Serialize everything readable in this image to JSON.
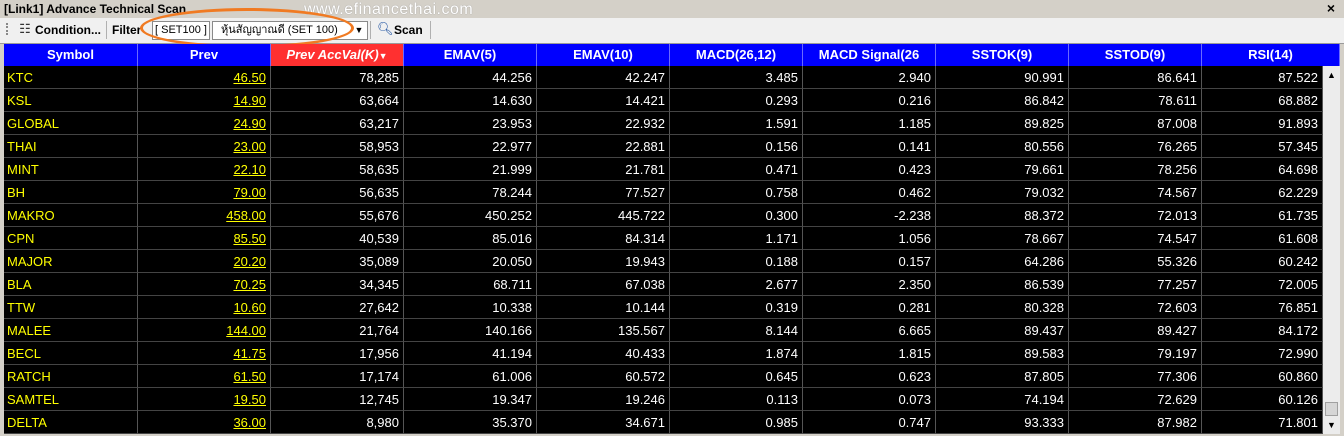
{
  "window": {
    "title": "[Link1] Advance Technical Scan",
    "watermark": "www.efinancethai.com",
    "close_glyph": "×"
  },
  "toolbar": {
    "condition_label": "Condition...",
    "filter_label": "Filter",
    "filter_value": "[ SET100 ]",
    "combo_value": "หุ้นสัญญาณดี (SET 100)",
    "scan_label": "Scan"
  },
  "icons": {
    "condition": "grid-settings-icon",
    "scan": "magnifier-icon",
    "combo_arrow": "dropdown-arrow-icon"
  },
  "colors": {
    "header_bg": "#0000ff",
    "active_header_bg": "#ff3030",
    "grid_bg": "#000000",
    "symbol_text": "#ffff00",
    "highlight_oval": "#f07a22"
  },
  "grid": {
    "columns": [
      "Symbol",
      "Prev",
      "Prev AccVal(K)",
      "EMAV(5)",
      "EMAV(10)",
      "MACD(26,12)",
      "MACD Signal(26",
      "SSTOK(9)",
      "SSTOD(9)",
      "RSI(14)"
    ],
    "sort_indicator": "▼",
    "rows": [
      [
        "KTC",
        "46.50",
        "78,285",
        "44.256",
        "42.247",
        "3.485",
        "2.940",
        "90.991",
        "86.641",
        "87.522"
      ],
      [
        "KSL",
        "14.90",
        "63,664",
        "14.630",
        "14.421",
        "0.293",
        "0.216",
        "86.842",
        "78.611",
        "68.882"
      ],
      [
        "GLOBAL",
        "24.90",
        "63,217",
        "23.953",
        "22.932",
        "1.591",
        "1.185",
        "89.825",
        "87.008",
        "91.893"
      ],
      [
        "THAI",
        "23.00",
        "58,953",
        "22.977",
        "22.881",
        "0.156",
        "0.141",
        "80.556",
        "76.265",
        "57.345"
      ],
      [
        "MINT",
        "22.10",
        "58,635",
        "21.999",
        "21.781",
        "0.471",
        "0.423",
        "79.661",
        "78.256",
        "64.698"
      ],
      [
        "BH",
        "79.00",
        "56,635",
        "78.244",
        "77.527",
        "0.758",
        "0.462",
        "79.032",
        "74.567",
        "62.229"
      ],
      [
        "MAKRO",
        "458.00",
        "55,676",
        "450.252",
        "445.722",
        "0.300",
        "-2.238",
        "88.372",
        "72.013",
        "61.735"
      ],
      [
        "CPN",
        "85.50",
        "40,539",
        "85.016",
        "84.314",
        "1.171",
        "1.056",
        "78.667",
        "74.547",
        "61.608"
      ],
      [
        "MAJOR",
        "20.20",
        "35,089",
        "20.050",
        "19.943",
        "0.188",
        "0.157",
        "64.286",
        "55.326",
        "60.242"
      ],
      [
        "BLA",
        "70.25",
        "34,345",
        "68.711",
        "67.038",
        "2.677",
        "2.350",
        "86.539",
        "77.257",
        "72.005"
      ],
      [
        "TTW",
        "10.60",
        "27,642",
        "10.338",
        "10.144",
        "0.319",
        "0.281",
        "80.328",
        "72.603",
        "76.851"
      ],
      [
        "MALEE",
        "144.00",
        "21,764",
        "140.166",
        "135.567",
        "8.144",
        "6.665",
        "89.437",
        "89.427",
        "84.172"
      ],
      [
        "BECL",
        "41.75",
        "17,956",
        "41.194",
        "40.433",
        "1.874",
        "1.815",
        "89.583",
        "79.197",
        "72.990"
      ],
      [
        "RATCH",
        "61.50",
        "17,174",
        "61.006",
        "60.572",
        "0.645",
        "0.623",
        "87.805",
        "77.306",
        "60.860"
      ],
      [
        "SAMTEL",
        "19.50",
        "12,745",
        "19.347",
        "19.246",
        "0.113",
        "0.073",
        "74.194",
        "72.629",
        "60.126"
      ],
      [
        "DELTA",
        "36.00",
        "8,980",
        "35.370",
        "34.671",
        "0.985",
        "0.747",
        "93.333",
        "87.982",
        "71.801"
      ]
    ]
  }
}
